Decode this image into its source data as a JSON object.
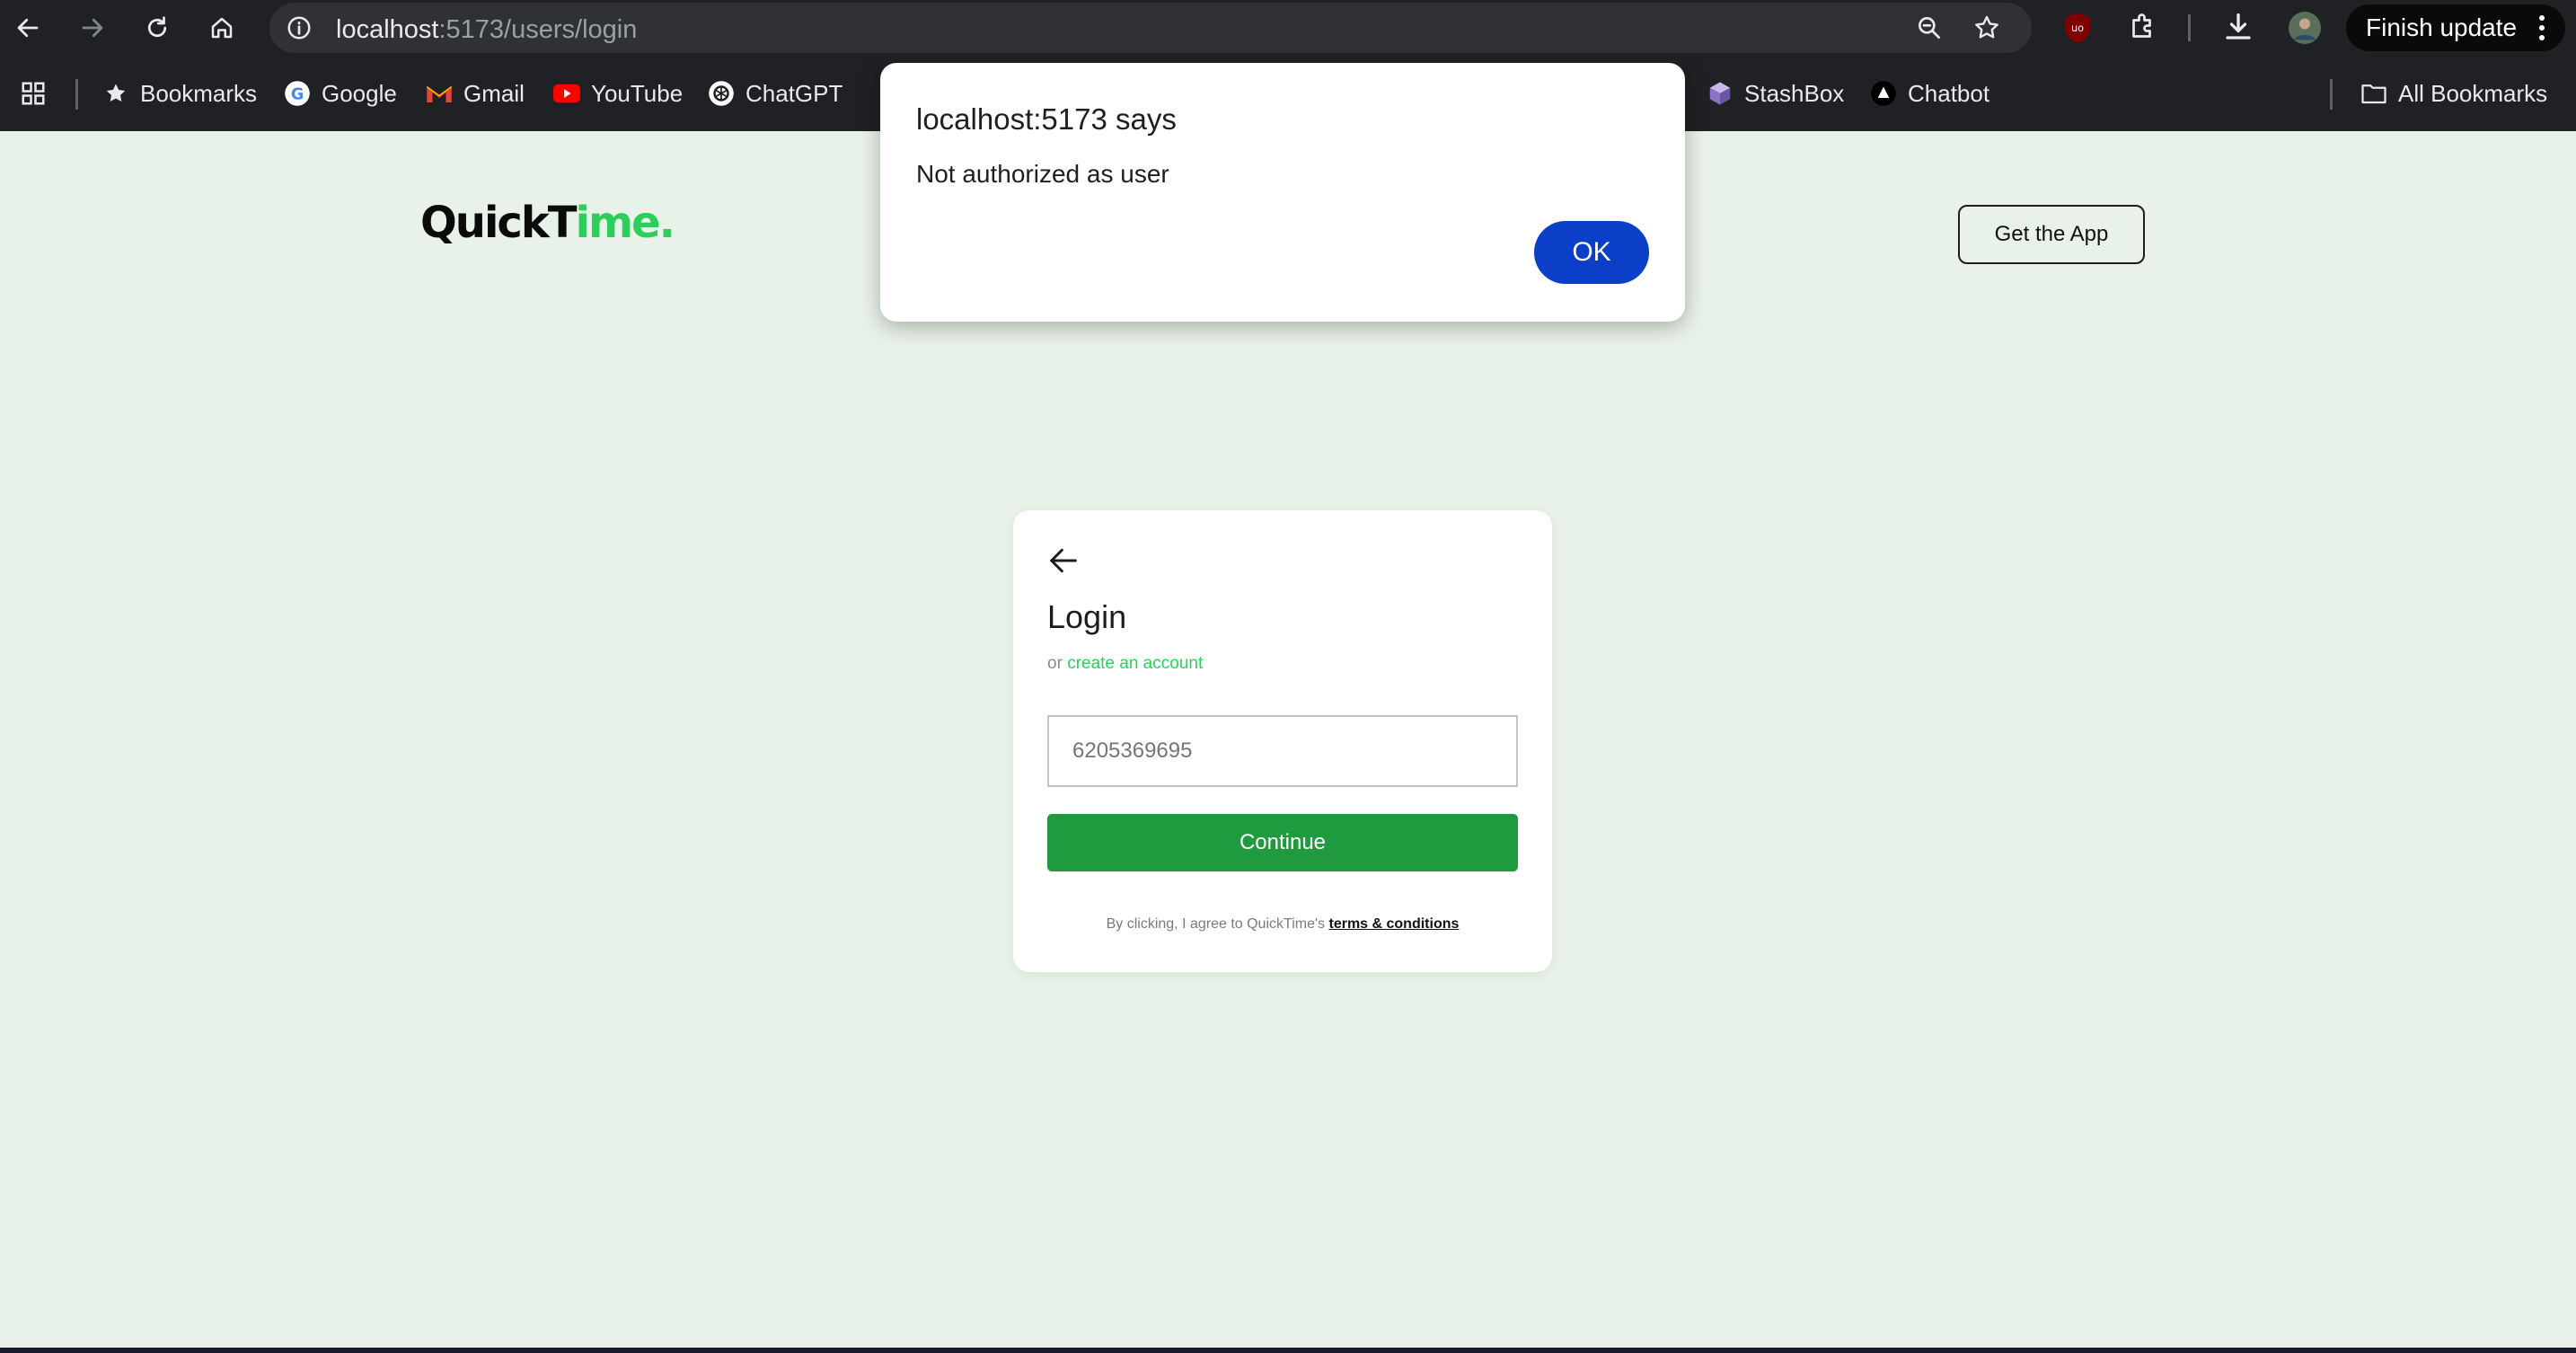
{
  "browser": {
    "url_host": "localhost",
    "url_path": ":5173/users/login",
    "finish_update_label": "Finish update"
  },
  "bookmarks": {
    "items": [
      {
        "label": "Bookmarks",
        "icon": "star-icon"
      },
      {
        "label": "Google",
        "icon": "google-icon"
      },
      {
        "label": "Gmail",
        "icon": "gmail-icon"
      },
      {
        "label": "YouTube",
        "icon": "youtube-icon"
      },
      {
        "label": "ChatGPT",
        "icon": "chatgpt-icon"
      },
      {
        "label": "StashBox",
        "icon": "stashbox-icon"
      },
      {
        "label": "Chatbot",
        "icon": "chatbot-icon"
      }
    ],
    "all_bookmarks_label": "All Bookmarks"
  },
  "header": {
    "logo_main": "QuickT",
    "logo_accent": "ime.",
    "get_app_label": "Get the App"
  },
  "login": {
    "title": "Login",
    "or_text": "or",
    "create_account_label": "create an account",
    "phone_placeholder": "6205369695",
    "continue_label": "Continue",
    "terms_prefix": "By clicking, I agree to QuickTime's",
    "terms_link": "terms & conditions"
  },
  "dialog": {
    "title": "localhost:5173 says",
    "message": "Not authorized as user",
    "ok_label": "OK"
  },
  "colors": {
    "page_background": "#e8f2e8",
    "brand_green": "#2ccf5a",
    "continue_green": "#1f9a3f",
    "dialog_button_blue": "#0b3fc7"
  }
}
